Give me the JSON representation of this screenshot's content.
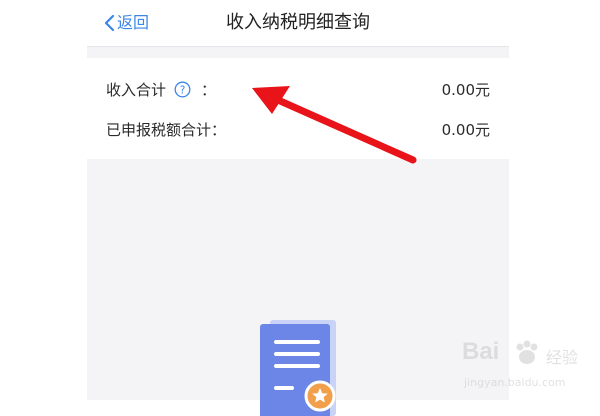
{
  "nav": {
    "back_label": "返回",
    "title": "收入纳税明细查询"
  },
  "summary": {
    "income_total_label": "收入合计",
    "income_total_colon": "：",
    "income_total_value": "0.00元",
    "declared_tax_label": "已申报税额合计：",
    "declared_tax_value": "0.00元"
  },
  "icons": {
    "back": "chevron-left-icon",
    "help": "question-circle-icon",
    "empty_state": "document-star-icon"
  },
  "colors": {
    "accent": "#3b86e8",
    "background": "#f4f4f6",
    "annotation_arrow": "#e8141a"
  },
  "watermark": {
    "brand": "Bai",
    "brand_cn": "经验",
    "url": "jingyan.baidu.com"
  }
}
